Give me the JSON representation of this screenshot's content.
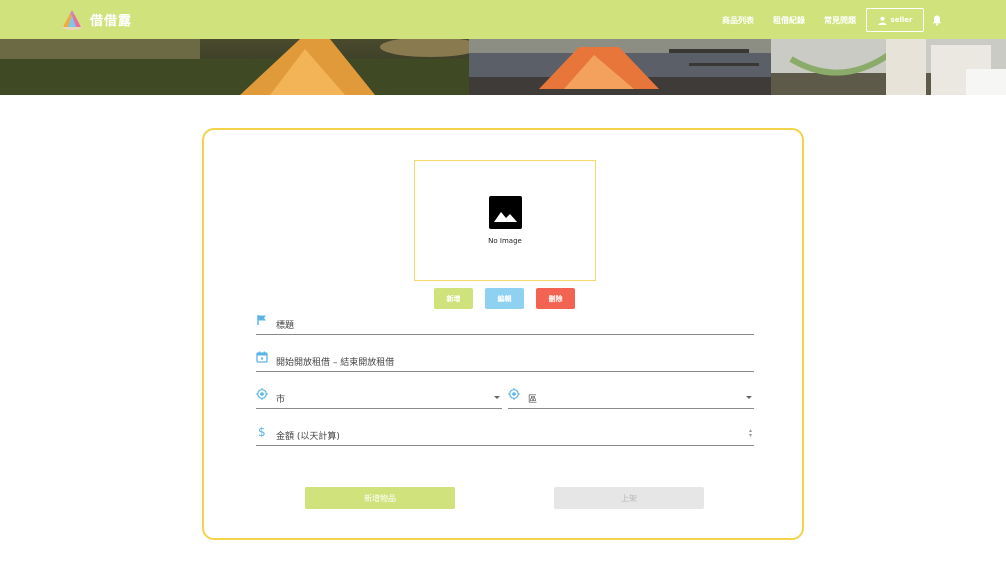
{
  "brand": {
    "name": "借借露"
  },
  "nav": {
    "links": [
      "商品列表",
      "租借紀錄",
      "常見問題"
    ],
    "user_label": "seller"
  },
  "upload": {
    "no_image": "No Image",
    "add_label": "新增",
    "edit_label": "編輯",
    "delete_label": "刪除"
  },
  "form": {
    "title_placeholder": "標題",
    "date_placeholder": "開始開放租借 – 結束開放租借",
    "city_placeholder": "市",
    "district_placeholder": "區",
    "price_placeholder": "金額 (以天計算)"
  },
  "actions": {
    "submit_label": "新增物品",
    "publish_label": "上架"
  },
  "colors": {
    "navbar": "#cfe27c",
    "card_border": "#f3d34a",
    "add": "#cfe27c",
    "edit": "#8fd1f0",
    "delete": "#f26352",
    "icon": "#5ab4e6",
    "publish_disabled": "#e6e6e6"
  }
}
